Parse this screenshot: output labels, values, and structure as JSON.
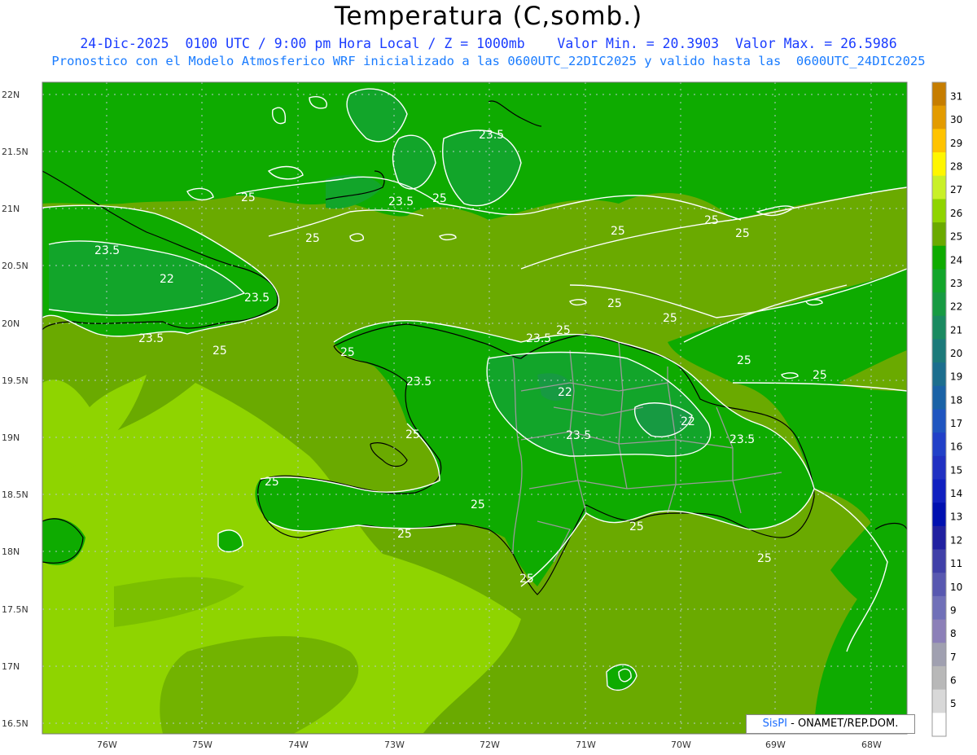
{
  "title": "Temperatura (C,somb.)",
  "subtitle1": "24-Dic-2025  0100 UTC / 9:00 pm Hora Local / Z = 1000mb    Valor Min. = 20.3903  Valor Max. = 26.5986",
  "subtitle2": "Pronostico con el Modelo Atmosferico WRF inicializado a las 0600UTC_22DIC2025 y valido hasta las  0600UTC_24DIC2025",
  "credit": {
    "brand": "SisPI",
    "text": " - ONAMET/REP.DOM."
  },
  "lat_labels": [
    "22N",
    "21.5N",
    "21N",
    "20.5N",
    "20N",
    "19.5N",
    "19N",
    "18.5N",
    "18N",
    "17.5N",
    "17N",
    "16.5N"
  ],
  "lon_labels": [
    "76W",
    "75W",
    "74W",
    "73W",
    "72W",
    "71W",
    "70W",
    "69W",
    "68W"
  ],
  "colorbar": [
    {
      "label": "31",
      "color": "#c67d00"
    },
    {
      "label": "30",
      "color": "#e39b00"
    },
    {
      "label": "29",
      "color": "#ffc300"
    },
    {
      "label": "28",
      "color": "#fff600"
    },
    {
      "label": "27",
      "color": "#c9f028"
    },
    {
      "label": "26",
      "color": "#8fd400"
    },
    {
      "label": "25",
      "color": "#6aaa00"
    },
    {
      "label": "24",
      "color": "#0eab00"
    },
    {
      "label": "23",
      "color": "#12a52a"
    },
    {
      "label": "22",
      "color": "#179a42"
    },
    {
      "label": "21",
      "color": "#1a8a60"
    },
    {
      "label": "20",
      "color": "#1c7a7a"
    },
    {
      "label": "19",
      "color": "#1c6e8e"
    },
    {
      "label": "18",
      "color": "#1a62a6"
    },
    {
      "label": "17",
      "color": "#1f55c0"
    },
    {
      "label": "16",
      "color": "#2140c8"
    },
    {
      "label": "15",
      "color": "#2030c2"
    },
    {
      "label": "14",
      "color": "#1020c0"
    },
    {
      "label": "13",
      "color": "#0010b0"
    },
    {
      "label": "12",
      "color": "#2020a0"
    },
    {
      "label": "11",
      "color": "#4040a8"
    },
    {
      "label": "10",
      "color": "#5858b0"
    },
    {
      "label": "9",
      "color": "#7070b8"
    },
    {
      "label": "8",
      "color": "#8c80b8"
    },
    {
      "label": "7",
      "color": "#a0a0b0"
    },
    {
      "label": "6",
      "color": "#b8b8b8"
    },
    {
      "label": "5",
      "color": "#d8d8d8"
    },
    {
      "label": "",
      "color": "#ffffff"
    }
  ],
  "contour_labels": [
    "23.5",
    "25",
    "25",
    "25",
    "23.5",
    "25",
    "22",
    "23.5",
    "23.5",
    "25",
    "25",
    "25",
    "25",
    "25",
    "25",
    "25",
    "25",
    "23.5",
    "25",
    "25",
    "23.5",
    "22",
    "22",
    "23.5",
    "23.5",
    "23.5",
    "25",
    "25",
    "25",
    "25",
    "25",
    "25"
  ]
}
